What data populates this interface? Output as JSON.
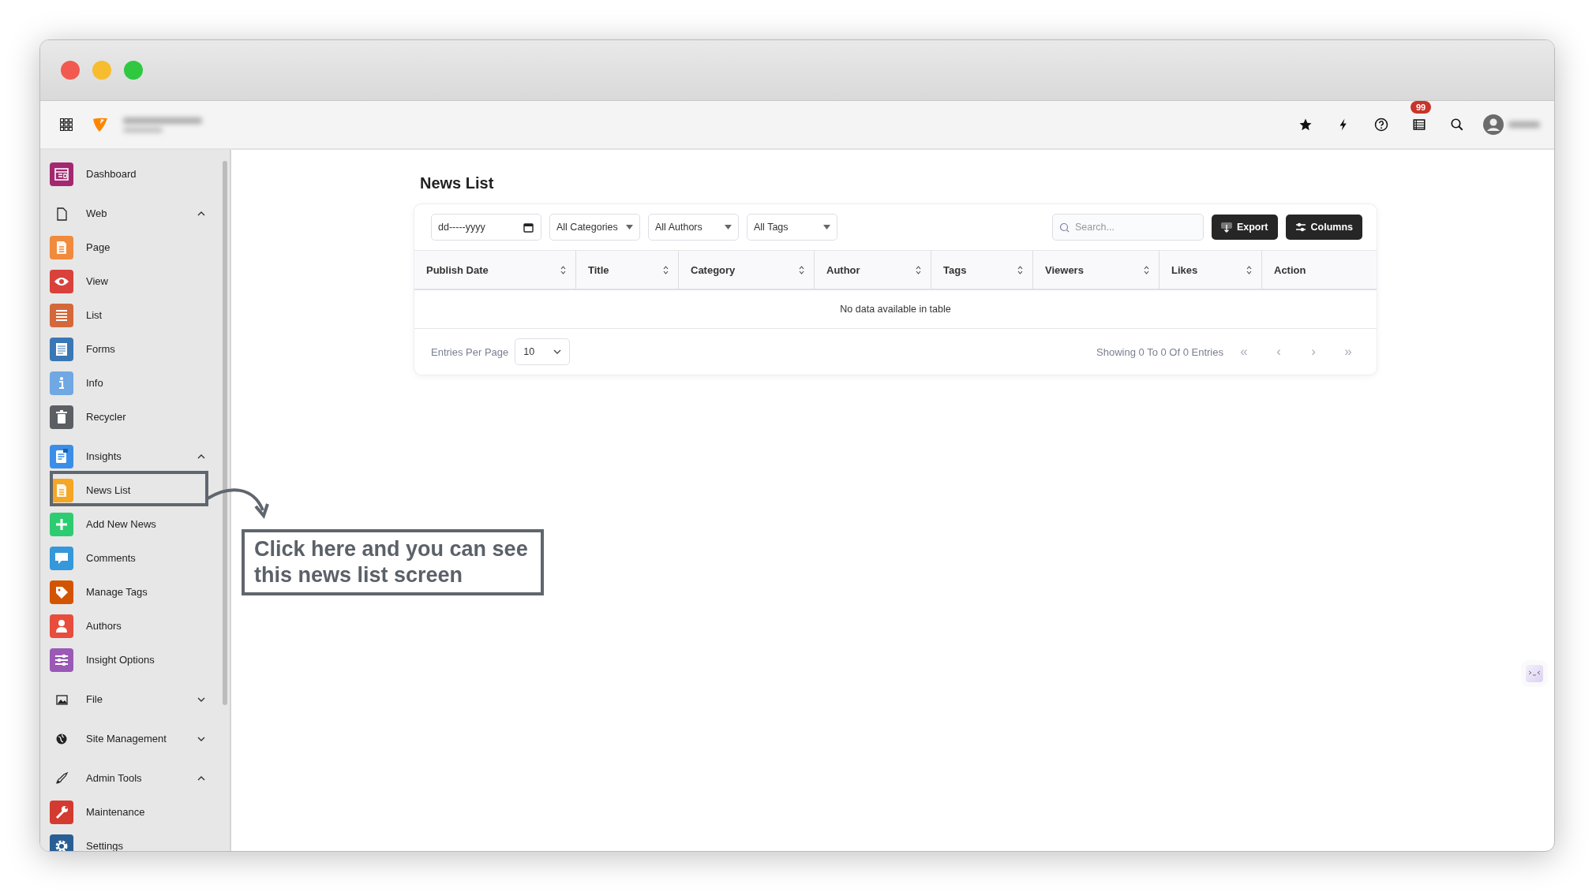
{
  "topbar": {
    "notification_badge": "99"
  },
  "sidebar": {
    "items": [
      {
        "kind": "module",
        "label": "Dashboard",
        "color": "#a3286f"
      },
      {
        "kind": "group",
        "label": "Web",
        "expanded": true,
        "children": [
          {
            "kind": "module",
            "label": "Page",
            "color": "#f08a3c"
          },
          {
            "kind": "module",
            "label": "View",
            "color": "#d9413b"
          },
          {
            "kind": "module",
            "label": "List",
            "color": "#d4683a"
          },
          {
            "kind": "module",
            "label": "Forms",
            "color": "#3a77b5"
          },
          {
            "kind": "module",
            "label": "Info",
            "color": "#6fa8e2"
          },
          {
            "kind": "module",
            "label": "Recycler",
            "color": "#5b5f63"
          }
        ]
      },
      {
        "kind": "group",
        "label": "Insights",
        "expanded": true,
        "children": [
          {
            "kind": "module",
            "label": "News List",
            "color": "#f5a623"
          },
          {
            "kind": "module",
            "label": "Add New News",
            "color": "#2ecc71"
          },
          {
            "kind": "module",
            "label": "Comments",
            "color": "#3498db"
          },
          {
            "kind": "module",
            "label": "Manage Tags",
            "color": "#d35400"
          },
          {
            "kind": "module",
            "label": "Authors",
            "color": "#e74c3c"
          },
          {
            "kind": "module",
            "label": "Insight Options",
            "color": "#9b59b6"
          }
        ]
      },
      {
        "kind": "group",
        "label": "File",
        "expanded": false
      },
      {
        "kind": "group",
        "label": "Site Management",
        "expanded": false
      },
      {
        "kind": "group",
        "label": "Admin Tools",
        "expanded": true,
        "children": [
          {
            "kind": "module",
            "label": "Maintenance",
            "color": "#d33a30"
          },
          {
            "kind": "module",
            "label": "Settings",
            "color": "#285e95"
          }
        ]
      }
    ]
  },
  "page": {
    "title": "News List",
    "date_filter": {
      "placeholder": "dd-----yyyy"
    },
    "filters": [
      "All Categories",
      "All Authors",
      "All Tags"
    ],
    "search": {
      "placeholder": "Search..."
    },
    "buttons": [
      {
        "kind": "export",
        "label": "Export"
      },
      {
        "kind": "columns",
        "label": "Columns"
      }
    ],
    "table": {
      "columns": [
        {
          "label": "Publish Date",
          "sortable": true
        },
        {
          "label": "Title",
          "sortable": true
        },
        {
          "label": "Category",
          "sortable": true
        },
        {
          "label": "Author",
          "sortable": true
        },
        {
          "label": "Tags",
          "sortable": true
        },
        {
          "label": "Viewers",
          "sortable": true
        },
        {
          "label": "Likes",
          "sortable": true
        },
        {
          "label": "Action",
          "sortable": false
        }
      ],
      "empty_message": "No data available in table"
    },
    "footer": {
      "entries_label": "Entries Per Page",
      "page_size": "10",
      "summary": "Showing 0 To 0 Of 0 Entries",
      "pager": [
        {
          "label": "«",
          "disabled": true
        },
        {
          "label": "‹",
          "disabled": true
        },
        {
          "label": "›",
          "disabled": true
        },
        {
          "label": "»",
          "disabled": true
        }
      ]
    }
  },
  "annotation": {
    "lines": [
      "Click here and you can see",
      "this news list screen"
    ]
  }
}
